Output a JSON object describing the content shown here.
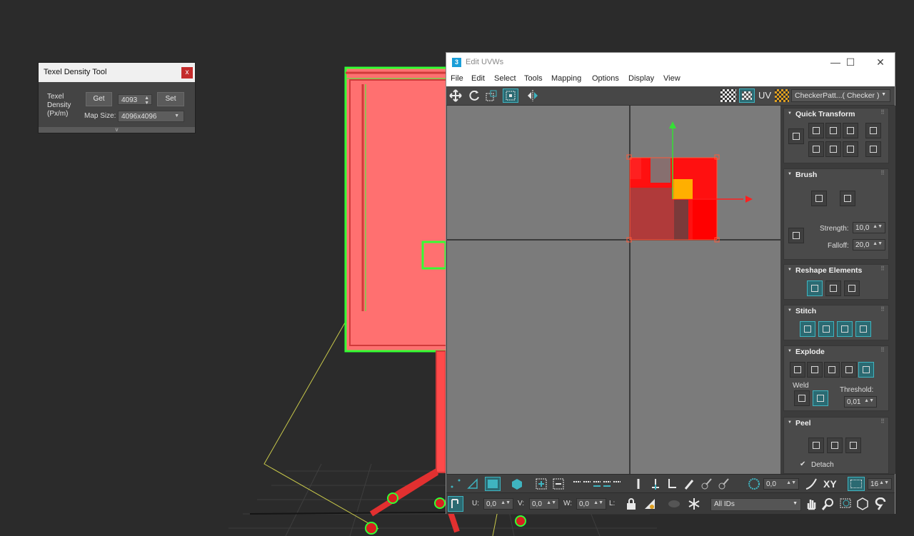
{
  "texel_tool": {
    "title": "Texel Density Tool",
    "close_label": "x",
    "density_label": "Texel Density (Px/m)",
    "get_label": "Get",
    "density_value": "4093",
    "set_label": "Set",
    "map_size_label": "Map Size:",
    "map_size_value": "4096x4096",
    "footer_glyph": "v"
  },
  "uvw": {
    "title": "Edit UVWs",
    "app_icon": "3",
    "window_controls": {
      "minimize": "—",
      "maximize": "☐",
      "close": "✕"
    },
    "menu": [
      "File",
      "Edit",
      "Select",
      "Tools",
      "Mapping",
      "Options",
      "Display",
      "View"
    ],
    "toolbar": {
      "uv_label": "UV",
      "checker_dropdown": "CheckerPatt...( Checker )"
    },
    "rollouts": {
      "quick_transform": "Quick Transform",
      "brush": "Brush",
      "strength_label": "Strength:",
      "strength_value": "10,0",
      "falloff_label": "Falloff:",
      "falloff_value": "20,0",
      "reshape": "Reshape Elements",
      "stitch": "Stitch",
      "explode": "Explode",
      "weld_label": "Weld",
      "threshold_label": "Threshold:",
      "threshold_value": "0,01",
      "peel": "Peel",
      "detach_label": "Detach",
      "detach_checked": "✔"
    },
    "bottom": {
      "rotate_value": "0,0",
      "xy_label": "XY",
      "grid_value": "16",
      "u_label": "U:",
      "u_value": "0,0",
      "v_label": "V:",
      "v_value": "0,0",
      "w_label": "W:",
      "w_value": "0,0",
      "l_label": "L:",
      "ids_value": "All IDs"
    }
  },
  "colors": {
    "viewport_bg": "#2b2b2b",
    "selection_red": "#ff0000",
    "wire_green": "#33ff33",
    "panel_bg": "#444444",
    "accent_cyan": "#3fb4c0"
  },
  "icons": [
    "move-icon",
    "rotate-icon",
    "scale-icon",
    "freeform-icon",
    "mirror-icon",
    "checker-icon",
    "brush-icon",
    "hand-pan-icon",
    "zoom-icon",
    "lock-icon",
    "snowflake-icon"
  ]
}
